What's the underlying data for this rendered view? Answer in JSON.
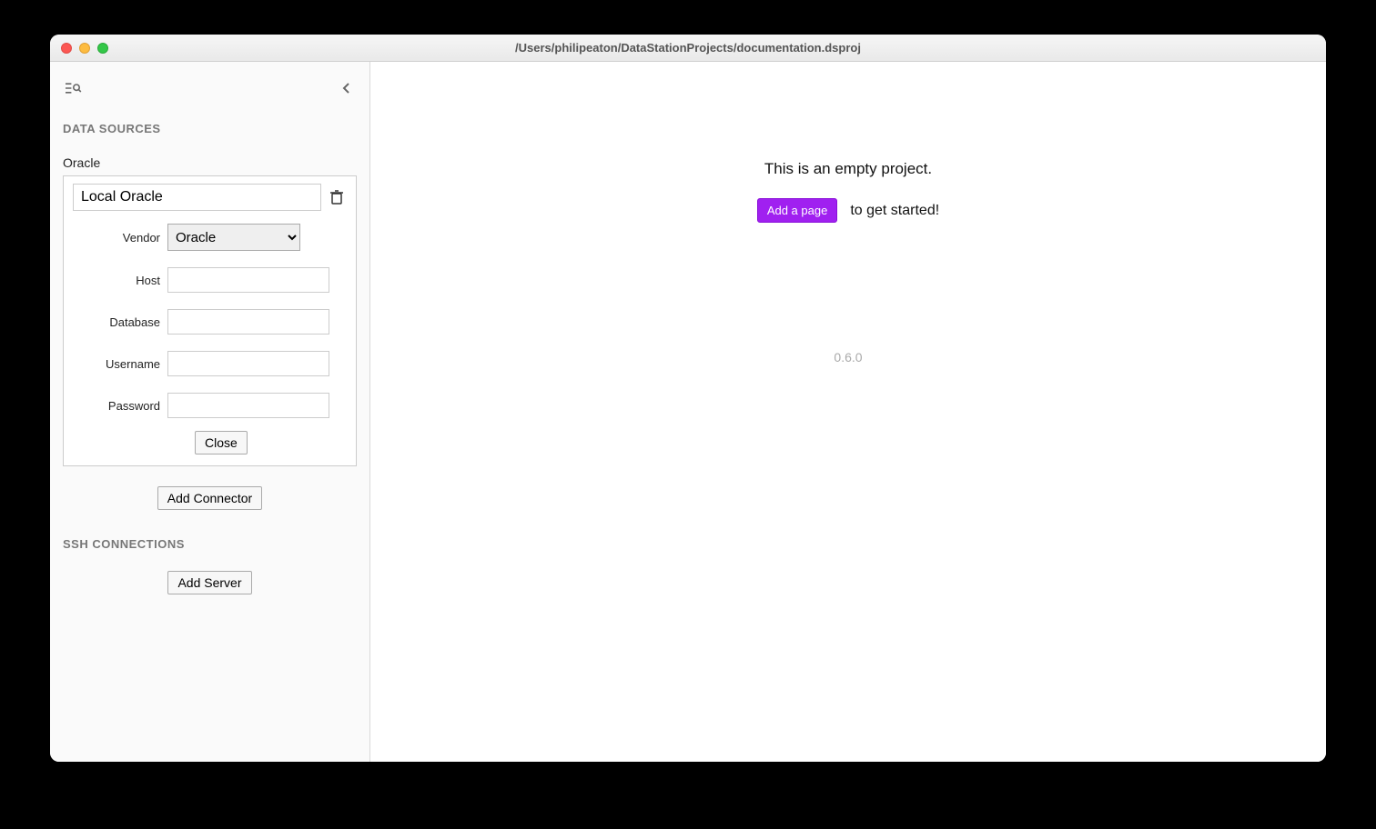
{
  "window": {
    "title": "/Users/philipeaton/DataStationProjects/documentation.dsproj"
  },
  "sidebar": {
    "data_sources_header": "DATA SOURCES",
    "ds_type_label": "Oracle",
    "connector": {
      "name_value": "Local Oracle",
      "vendor_label": "Vendor",
      "vendor_selected": "Oracle",
      "host_label": "Host",
      "host_value": "",
      "database_label": "Database",
      "database_value": "",
      "username_label": "Username",
      "username_value": "",
      "password_label": "Password",
      "password_value": "",
      "close_label": "Close"
    },
    "add_connector_label": "Add Connector",
    "ssh_header": "SSH CONNECTIONS",
    "add_server_label": "Add Server"
  },
  "main": {
    "empty_message": "This is an empty project.",
    "add_page_label": "Add a page",
    "get_started_text": "to get started!",
    "version": "0.6.0"
  }
}
